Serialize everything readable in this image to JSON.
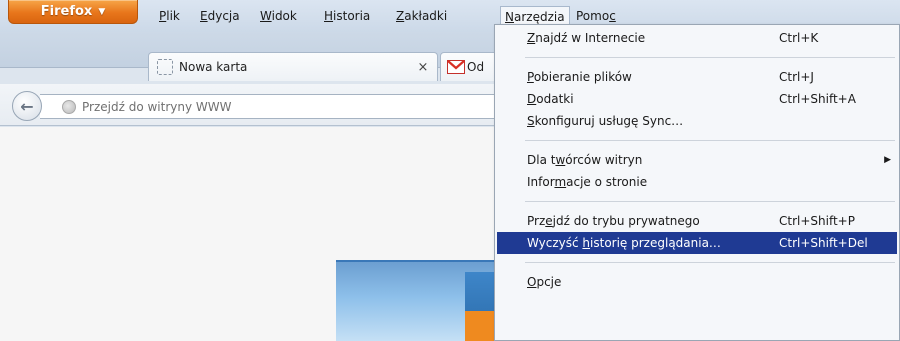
{
  "firefox_button": {
    "label": "Firefox",
    "caret": "▼"
  },
  "menubar": {
    "items": [
      {
        "key": "P",
        "rest": "lik"
      },
      {
        "key": "E",
        "rest": "dycja"
      },
      {
        "key": "W",
        "rest": "idok"
      },
      {
        "key": "H",
        "rest": "istoria"
      },
      {
        "key": "Z",
        "rest": "akładki"
      },
      {
        "key": "N",
        "rest": "arzędzia"
      },
      {
        "pre": "Pomo",
        "key": "c"
      }
    ]
  },
  "tabs": {
    "new_tab": {
      "title": "Nowa karta",
      "close": "×"
    },
    "gmail": {
      "title": "Od"
    }
  },
  "navbar": {
    "back_glyph": "←",
    "url_placeholder": "Przejdź do witryny WWW"
  },
  "dropdown": {
    "items": [
      {
        "pre": "",
        "key": "Z",
        "post": "najdź w Internecie",
        "shortcut": "Ctrl+K"
      },
      {
        "pre": "",
        "key": "P",
        "post": "obieranie plików",
        "shortcut": "Ctrl+J"
      },
      {
        "pre": "",
        "key": "D",
        "post": "odatki",
        "shortcut": "Ctrl+Shift+A"
      },
      {
        "pre": "",
        "key": "S",
        "post": "konfiguruj usługę Sync…",
        "shortcut": ""
      },
      {
        "pre": "Dla t",
        "key": "w",
        "post": "órców witryn",
        "shortcut": "",
        "arrow": "▶"
      },
      {
        "pre": "Infor",
        "key": "m",
        "post": "acje o stronie",
        "shortcut": ""
      },
      {
        "pre": "Prz",
        "key": "e",
        "post": "jdź do trybu prywatnego",
        "shortcut": "Ctrl+Shift+P"
      },
      {
        "pre": "Wyczyść ",
        "key": "h",
        "post": "istorię przeglądania…",
        "shortcut": "Ctrl+Shift+Del"
      },
      {
        "pre": "",
        "key": "O",
        "post": "pcje",
        "shortcut": ""
      }
    ]
  },
  "colors": {
    "highlight": "#1f3a93",
    "firefox_orange": "#e8761b"
  }
}
